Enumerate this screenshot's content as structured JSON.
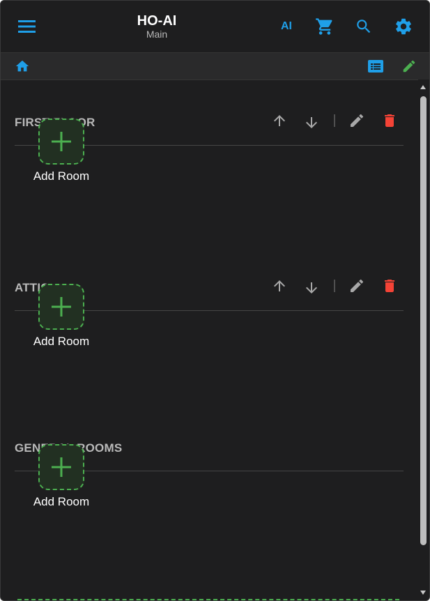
{
  "header": {
    "title": "HO-AI",
    "subtitle": "Main",
    "ai_label": "AI",
    "icons": [
      "menu-icon",
      "cart-icon",
      "search-icon",
      "gear-icon"
    ]
  },
  "subbar": {
    "icons": [
      "home-icon",
      "list-icon",
      "pencil-icon"
    ]
  },
  "floors": [
    {
      "name": "FIRST FLOOR",
      "add_label": "Add Room",
      "has_actions": true
    },
    {
      "name": "ATTIC",
      "add_label": "Add Room",
      "has_actions": true
    },
    {
      "name": "GENERAL ROOMS",
      "add_label": "Add Room",
      "has_actions": false
    }
  ],
  "colors": {
    "background": "#1e1e1f",
    "accent_blue": "#1f9fe8",
    "accent_green": "#4caf50",
    "delete_red": "#f44336",
    "muted_icon": "#a8a8a8"
  }
}
